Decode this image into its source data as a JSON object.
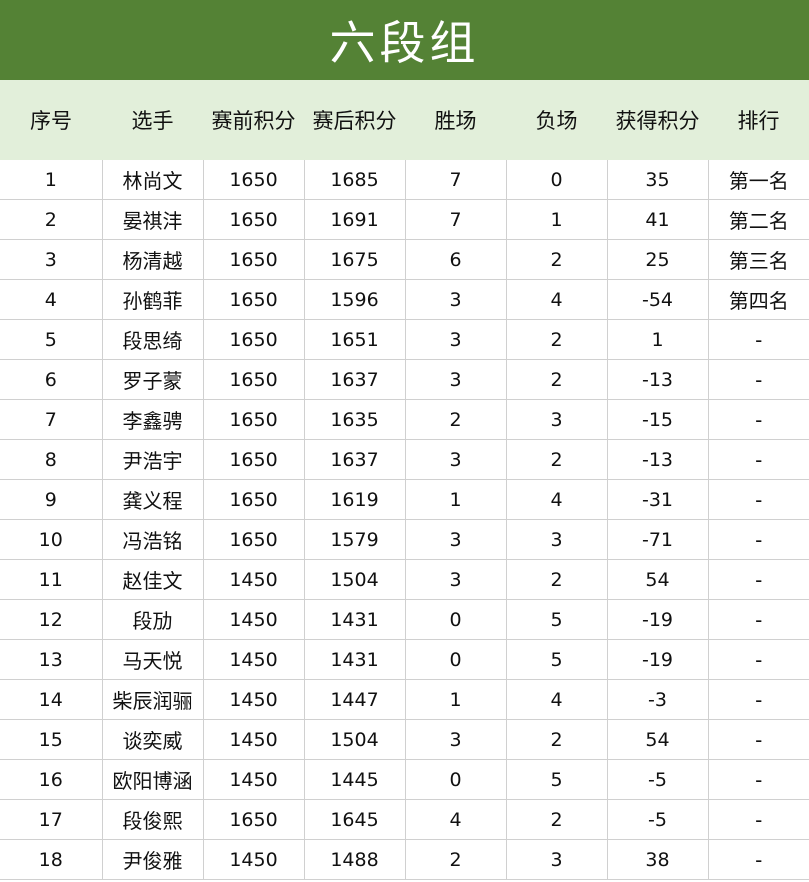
{
  "title": "六段组",
  "columns": [
    "序号",
    "选手",
    "赛前积分",
    "赛后积分",
    "胜场",
    "负场",
    "获得积分",
    "排行"
  ],
  "rows": [
    [
      "1",
      "林尚文",
      "1650",
      "1685",
      "7",
      "0",
      "35",
      "第一名"
    ],
    [
      "2",
      "晏祺沣",
      "1650",
      "1691",
      "7",
      "1",
      "41",
      "第二名"
    ],
    [
      "3",
      "杨清越",
      "1650",
      "1675",
      "6",
      "2",
      "25",
      "第三名"
    ],
    [
      "4",
      "孙鹤菲",
      "1650",
      "1596",
      "3",
      "4",
      "-54",
      "第四名"
    ],
    [
      "5",
      "段思绮",
      "1650",
      "1651",
      "3",
      "2",
      "1",
      "-"
    ],
    [
      "6",
      "罗子蒙",
      "1650",
      "1637",
      "3",
      "2",
      "-13",
      "-"
    ],
    [
      "7",
      "李鑫骋",
      "1650",
      "1635",
      "2",
      "3",
      "-15",
      "-"
    ],
    [
      "8",
      "尹浩宇",
      "1650",
      "1637",
      "3",
      "2",
      "-13",
      "-"
    ],
    [
      "9",
      "龚义程",
      "1650",
      "1619",
      "1",
      "4",
      "-31",
      "-"
    ],
    [
      "10",
      "冯浩铭",
      "1650",
      "1579",
      "3",
      "3",
      "-71",
      "-"
    ],
    [
      "11",
      "赵佳文",
      "1450",
      "1504",
      "3",
      "2",
      "54",
      "-"
    ],
    [
      "12",
      "段劢",
      "1450",
      "1431",
      "0",
      "5",
      "-19",
      "-"
    ],
    [
      "13",
      "马天悦",
      "1450",
      "1431",
      "0",
      "5",
      "-19",
      "-"
    ],
    [
      "14",
      "柴辰润骊",
      "1450",
      "1447",
      "1",
      "4",
      "-3",
      "-"
    ],
    [
      "15",
      "谈奕威",
      "1450",
      "1504",
      "3",
      "2",
      "54",
      "-"
    ],
    [
      "16",
      "欧阳博涵",
      "1450",
      "1445",
      "0",
      "5",
      "-5",
      "-"
    ],
    [
      "17",
      "段俊熙",
      "1650",
      "1645",
      "4",
      "2",
      "-5",
      "-"
    ],
    [
      "18",
      "尹俊雅",
      "1450",
      "1488",
      "2",
      "3",
      "38",
      "-"
    ]
  ]
}
